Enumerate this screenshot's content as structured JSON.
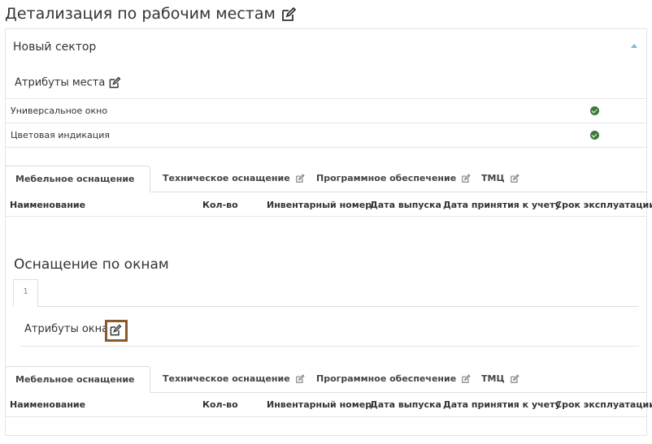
{
  "page": {
    "title": "Детализация по рабочим местам"
  },
  "sector": {
    "name": "Новый сектор",
    "attributes_heading": "Атрибуты места",
    "attributes": [
      {
        "label": "Универсальное окно",
        "checked": true
      },
      {
        "label": "Цветовая индикация",
        "checked": true
      }
    ]
  },
  "tabs": [
    {
      "label": "Мебельное оснащение",
      "active": true
    },
    {
      "label": "Техническое оснащение",
      "active": false
    },
    {
      "label": "Программное обеспечение",
      "active": false
    },
    {
      "label": "ТМЦ",
      "active": false
    }
  ],
  "table": {
    "columns": [
      "Наименование",
      "Кол-во",
      "Инвентарный номер",
      "Дата выпуска",
      "Дата принятия к учету",
      "Срок эксплуатации"
    ]
  },
  "windows": {
    "title": "Оснащение по окнам",
    "window_tab": "1",
    "attributes_heading": "Атрибуты окна"
  },
  "colors": {
    "check": "#3a7a3a",
    "caret": "#7ab8d8",
    "highlight": "#8b5a2b",
    "window_tab_text": "#6a9a6a"
  }
}
